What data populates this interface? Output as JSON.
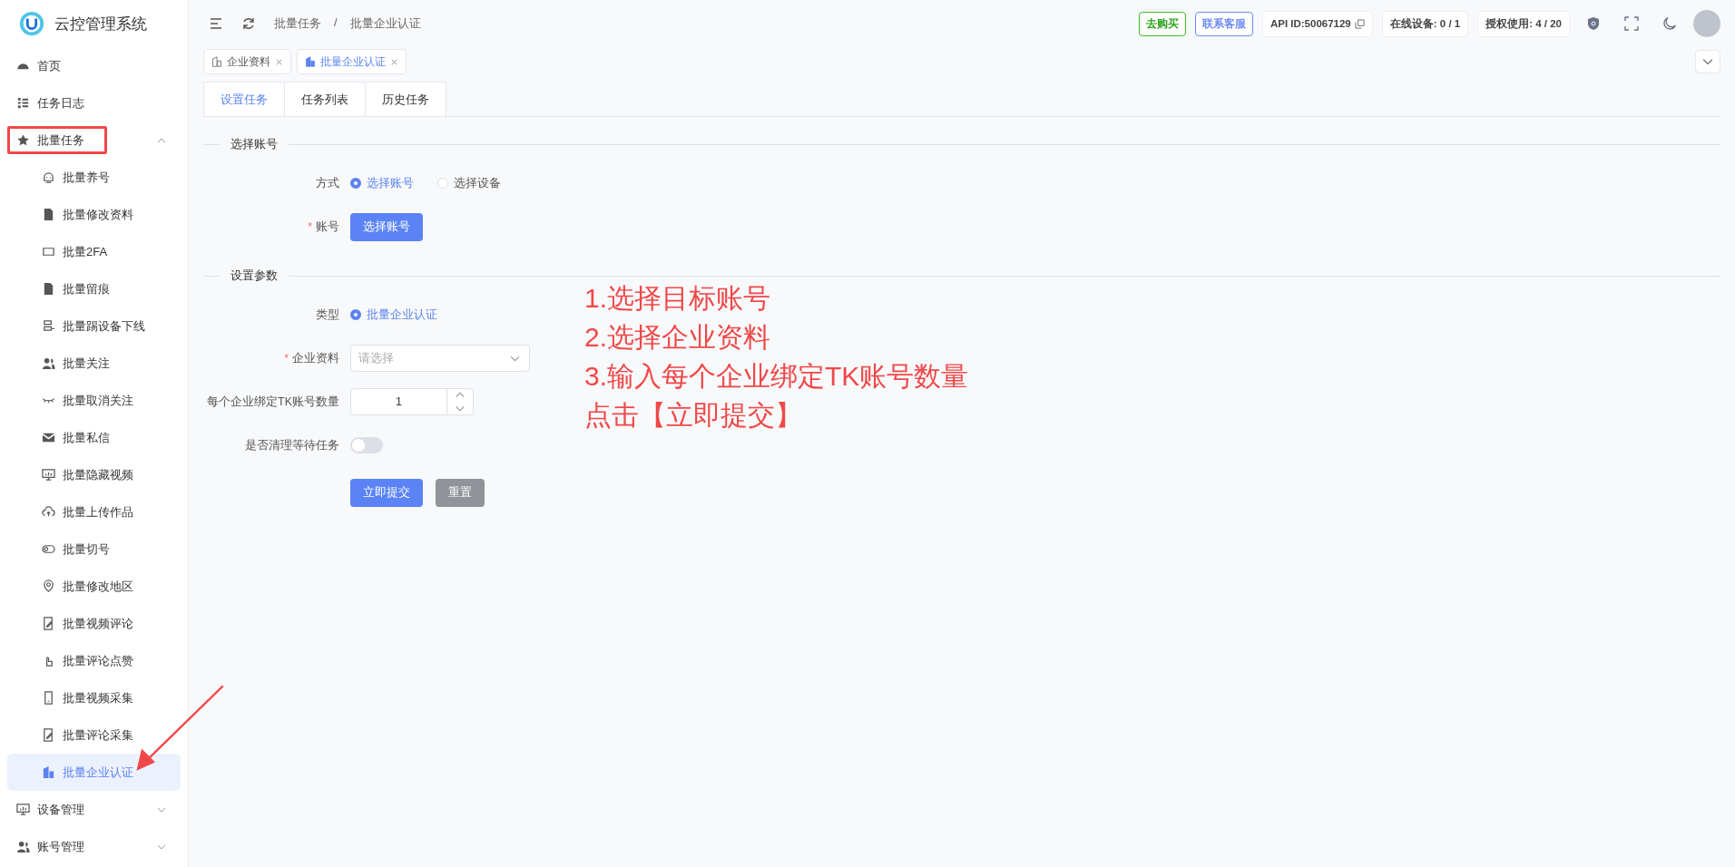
{
  "sidebar": {
    "title": "云控管理系统",
    "items": [
      {
        "label": "首页",
        "selected": false
      },
      {
        "label": "任务日志",
        "selected": false
      },
      {
        "label": "批量任务",
        "selected": false,
        "expanded": true,
        "highlighted": true,
        "children": [
          {
            "label": "批量养号",
            "selected": false
          },
          {
            "label": "批量修改资料",
            "selected": false
          },
          {
            "label": "批量2FA",
            "selected": false
          },
          {
            "label": "批量留痕",
            "selected": false
          },
          {
            "label": "批量踢设备下线",
            "selected": false
          },
          {
            "label": "批量关注",
            "selected": false
          },
          {
            "label": "批量取消关注",
            "selected": false
          },
          {
            "label": "批量私信",
            "selected": false
          },
          {
            "label": "批量隐藏视频",
            "selected": false
          },
          {
            "label": "批量上传作品",
            "selected": false
          },
          {
            "label": "批量切号",
            "selected": false
          },
          {
            "label": "批量修改地区",
            "selected": false
          },
          {
            "label": "批量视频评论",
            "selected": false
          },
          {
            "label": "批量评论点赞",
            "selected": false
          },
          {
            "label": "批量视频采集",
            "selected": false
          },
          {
            "label": "批量评论采集",
            "selected": false
          },
          {
            "label": "批量企业认证",
            "selected": true
          }
        ]
      },
      {
        "label": "设备管理",
        "selected": false,
        "expanded": false
      },
      {
        "label": "账号管理",
        "selected": false,
        "expanded": false
      }
    ]
  },
  "header": {
    "breadcrumb": [
      "批量任务",
      "批量企业认证"
    ],
    "breadcrumb_separator": "/",
    "buy_button": "去购买",
    "contact_button": "联系客服",
    "api_id": "API ID:50067129",
    "online_devices": "在线设备: 0 / 1",
    "license_usage": "授权使用: 4 / 20"
  },
  "page_tabs": [
    {
      "label": "企业资料",
      "selected": false
    },
    {
      "label": "批量企业认证",
      "selected": true
    }
  ],
  "tabs": [
    {
      "label": "设置任务",
      "selected": true
    },
    {
      "label": "任务列表",
      "selected": false
    },
    {
      "label": "历史任务",
      "selected": false
    }
  ],
  "form": {
    "required_mark": "*",
    "sections": [
      {
        "title": "选择账号",
        "fields": [
          {
            "kind": "radio",
            "label": "方式",
            "required": false,
            "options": [
              {
                "label": "选择账号",
                "selected": true
              },
              {
                "label": "选择设备",
                "selected": false
              }
            ]
          },
          {
            "kind": "button",
            "label": "账号",
            "required": true,
            "button": "选择账号"
          }
        ]
      },
      {
        "title": "设置参数",
        "fields": [
          {
            "kind": "radio",
            "label": "类型",
            "required": false,
            "options": [
              {
                "label": "批量企业认证",
                "selected": true
              }
            ]
          },
          {
            "kind": "select",
            "label": "企业资料",
            "required": true,
            "placeholder": "请选择"
          },
          {
            "kind": "number",
            "label": "每个企业绑定TK账号数量",
            "required": false,
            "value": "1"
          },
          {
            "kind": "switch",
            "label": "是否清理等待任务",
            "required": false,
            "on": false
          }
        ]
      }
    ],
    "actions": [
      {
        "kind": "primary",
        "label": "立即提交"
      },
      {
        "kind": "secondary",
        "label": "重置"
      }
    ]
  },
  "annotation": {
    "lines": [
      "1.选择目标账号",
      "2.选择企业资料",
      "3.输入每个企业绑定TK账号数量",
      "点击【立即提交】"
    ]
  }
}
